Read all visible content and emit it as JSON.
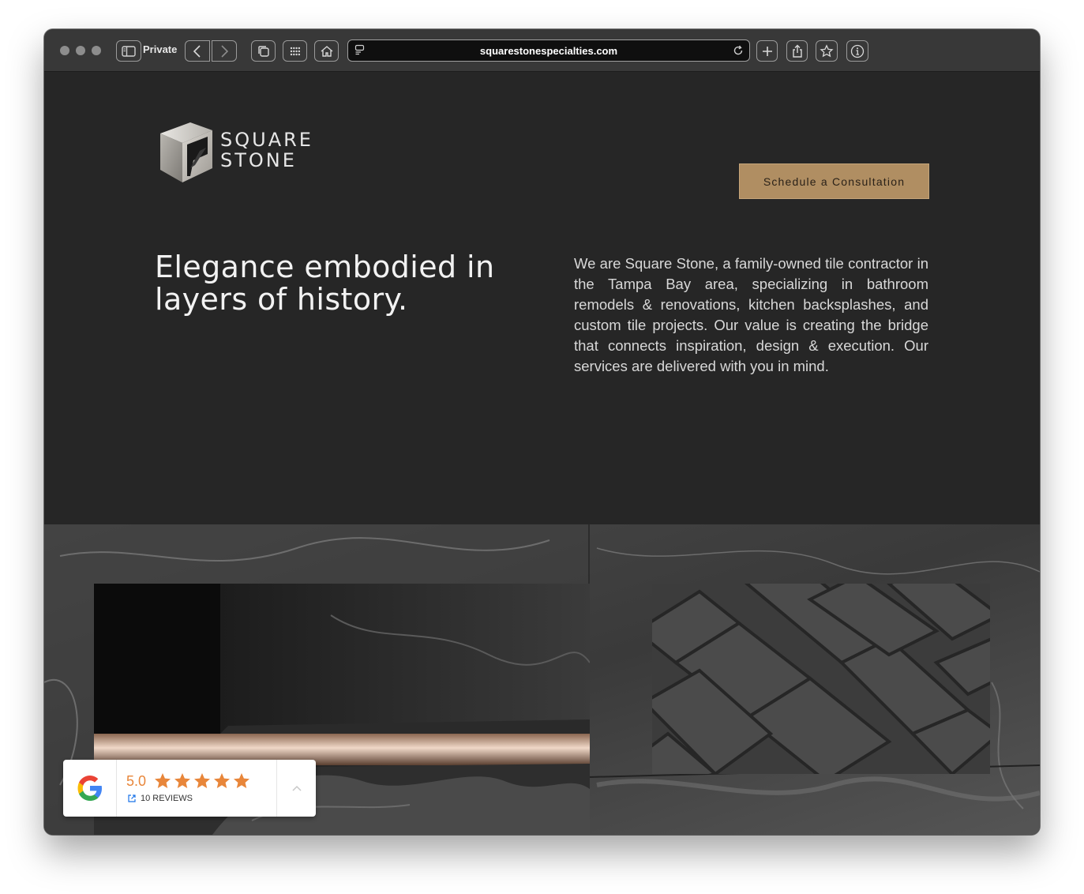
{
  "browser": {
    "private_label": "Private",
    "url": "squarestonespecialties.com"
  },
  "site": {
    "logo_line1": "SQUARE",
    "logo_line2": "STONE",
    "cta_label": "Schedule a Consultation",
    "headline": "Elegance embodied in layers of history.",
    "intro": "We are Square Stone, a family-owned tile contractor in the Tampa Bay area, specializing in bathroom remodels & renovations, kitchen backsplashes, and custom tile projects. Our value is creating the bridge that connects inspiration, design & execution. Our services are delivered with you in mind."
  },
  "reviews_widget": {
    "rating": "5.0",
    "stars": 5,
    "reviews_label": "10 REVIEWS",
    "star_color": "#e8863a"
  },
  "colors": {
    "page_bg": "#262626",
    "cta_bg": "#b08e62"
  }
}
